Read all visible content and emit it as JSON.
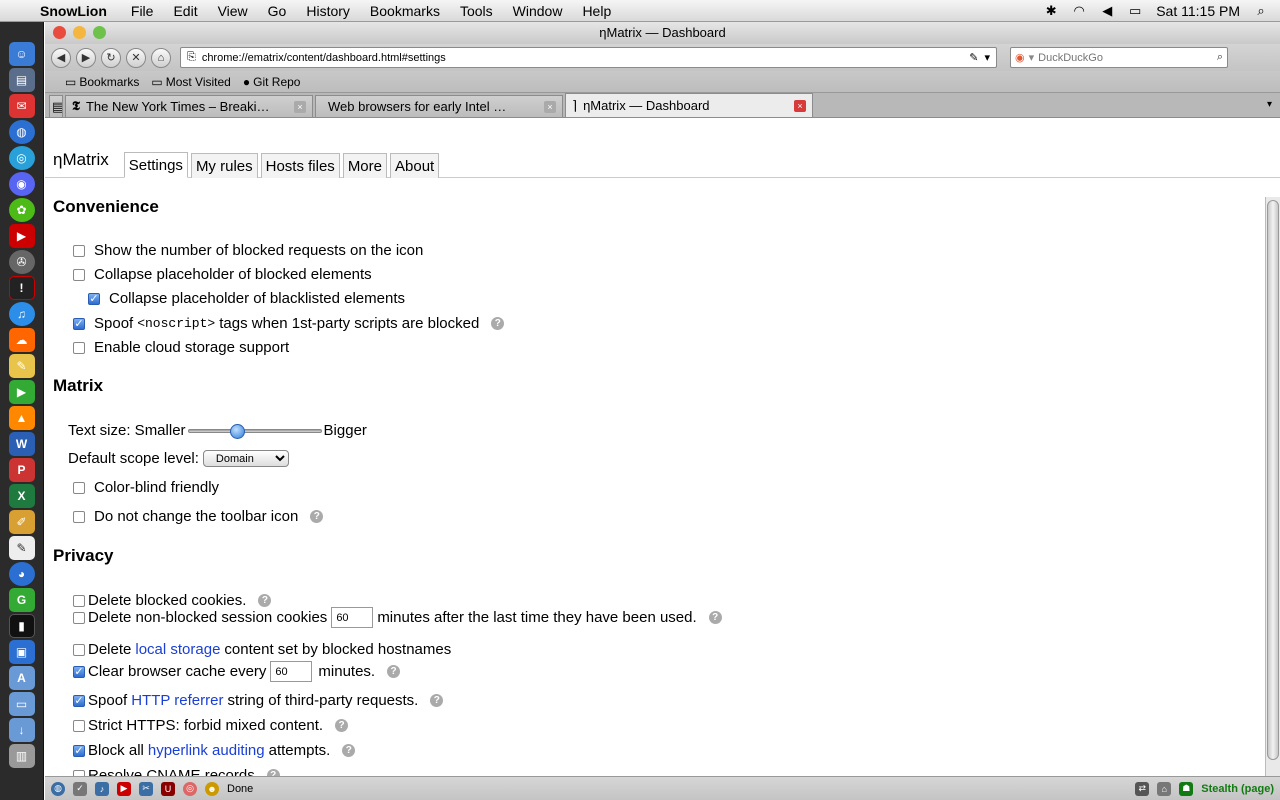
{
  "menubar": {
    "app_name": "SnowLion",
    "items": [
      "File",
      "Edit",
      "View",
      "Go",
      "History",
      "Bookmarks",
      "Tools",
      "Window",
      "Help"
    ],
    "clock": "Sat 11:15 PM",
    "status_icons": [
      "bluetooth-icon",
      "wifi-icon",
      "volume-icon",
      "battery-icon",
      "search-icon"
    ]
  },
  "window": {
    "title": "ηMatrix — Dashboard"
  },
  "navbar": {
    "url": "chrome://ematrix/content/dashboard.html#settings",
    "search_placeholder": "DuckDuckGo"
  },
  "bookmarks": [
    "Bookmarks",
    "Most Visited",
    "Git Repo"
  ],
  "tabs": [
    {
      "label": "The New York Times – Breaki…",
      "active": false
    },
    {
      "label": "Web browsers for early Intel …",
      "active": false
    },
    {
      "label": "ηMatrix — Dashboard",
      "active": true
    }
  ],
  "page": {
    "brand": "ηMatrix",
    "tabs": [
      "Settings",
      "My rules",
      "Hosts files",
      "More",
      "About"
    ],
    "convenience": {
      "heading": "Convenience",
      "show_blocked_count": "Show the number of blocked requests on the icon",
      "collapse_blocked": "Collapse placeholder of blocked elements",
      "collapse_blacklisted": "Collapse placeholder of blacklisted elements",
      "spoof_prefix": "Spoof",
      "spoof_code": "<noscript>",
      "spoof_suffix": "tags when 1st-party scripts are blocked",
      "cloud_storage": "Enable cloud storage support"
    },
    "matrix": {
      "heading": "Matrix",
      "text_size_label": "Text size: Smaller",
      "text_size_bigger": "Bigger",
      "text_size_value": 0.37,
      "scope_label": "Default scope level:",
      "scope_value": "Domain",
      "color_blind": "Color-blind friendly",
      "no_toolbar_change": "Do not change the toolbar icon"
    },
    "privacy": {
      "heading": "Privacy",
      "delete_blocked_cookies": "Delete blocked cookies.",
      "delete_session_prefix": "Delete non-blocked session cookies",
      "delete_session_value": "60",
      "delete_session_suffix": "minutes after the last time they have been used.",
      "delete_local_prefix": "Delete",
      "delete_local_link": "local storage",
      "delete_local_suffix": "content set by blocked hostnames",
      "clear_cache_prefix": "Clear browser cache every",
      "clear_cache_value": "60",
      "clear_cache_suffix": "minutes.",
      "spoof_referrer_prefix": "Spoof",
      "spoof_referrer_link": "HTTP referrer",
      "spoof_referrer_suffix": "string of third-party requests.",
      "strict_https": "Strict HTTPS: forbid mixed content.",
      "block_audit_prefix": "Block all",
      "block_audit_link": "hyperlink auditing",
      "block_audit_suffix": "attempts.",
      "resolve_cname": "Resolve CNAME records"
    }
  },
  "statusbar": {
    "status": "Done",
    "stealth": "Stealth (page)"
  },
  "colors": {
    "link": "#1a3fd6",
    "checkbox_checked": "#2d6dd1",
    "stealth_green": "#137a13",
    "active_tab_close": "#d63a3a"
  }
}
